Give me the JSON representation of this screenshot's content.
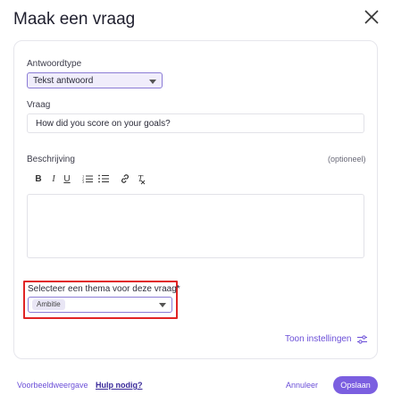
{
  "dialog": {
    "title": "Maak een vraag"
  },
  "form": {
    "answer_type": {
      "label": "Antwoordtype",
      "value": "Tekst antwoord"
    },
    "question": {
      "label": "Vraag",
      "value": "How did you score on your goals?"
    },
    "description": {
      "label": "Beschrijving",
      "optional": "(optioneel)"
    },
    "theme": {
      "label": "Selecteer een thema voor deze vraag*",
      "chip": "Ambitie"
    },
    "settings_link": "Toon instellingen"
  },
  "toolbar": {
    "bold": "B",
    "italic": "I",
    "underline": "U",
    "clear_format": "T"
  },
  "footer": {
    "preview": "Voorbeeldweergave",
    "help": "Hulp nodig?",
    "cancel": "Annuleer",
    "save": "Opslaan"
  },
  "colors": {
    "accent": "#7b5fe0",
    "highlight_border": "#e02424"
  }
}
